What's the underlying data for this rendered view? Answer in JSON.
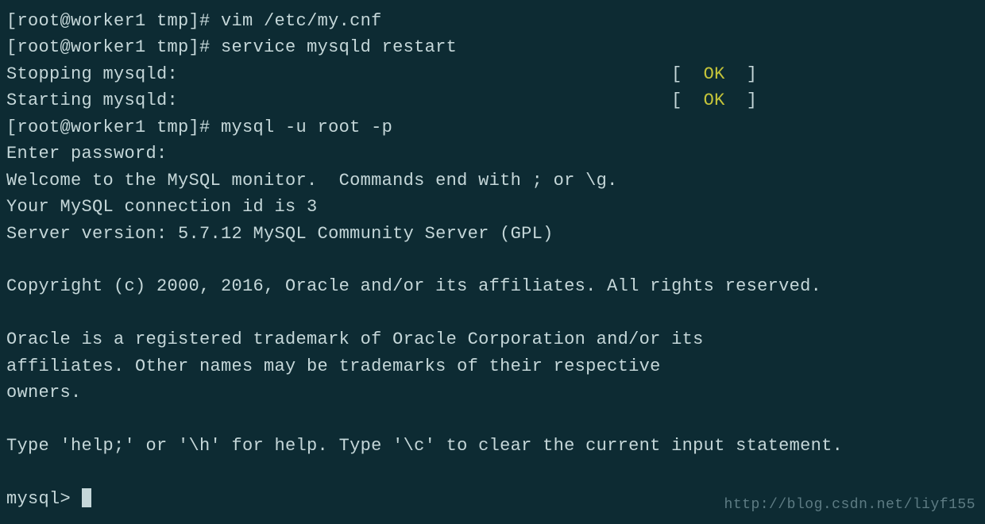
{
  "lines": {
    "l1_prompt": "[root@worker1 tmp]# ",
    "l1_cmd": "vim /etc/my.cnf",
    "l2_prompt": "[root@worker1 tmp]# ",
    "l2_cmd": "service mysqld restart",
    "l3_label": "Stopping mysqld:",
    "l3_gap": "                                              ",
    "l3_b1": "[  ",
    "l3_ok": "OK",
    "l3_b2": "  ]",
    "l4_label": "Starting mysqld:",
    "l4_gap": "                                              ",
    "l4_b1": "[  ",
    "l4_ok": "OK",
    "l4_b2": "  ]",
    "l5_prompt": "[root@worker1 tmp]# ",
    "l5_cmd": "mysql -u root -p",
    "l6": "Enter password:",
    "l7": "Welcome to the MySQL monitor.  Commands end with ; or \\g.",
    "l8": "Your MySQL connection id is 3",
    "l9": "Server version: 5.7.12 MySQL Community Server (GPL)",
    "l10": "Copyright (c) 2000, 2016, Oracle and/or its affiliates. All rights reserved.",
    "l11": "Oracle is a registered trademark of Oracle Corporation and/or its",
    "l12": "affiliates. Other names may be trademarks of their respective",
    "l13": "owners.",
    "l14": "Type 'help;' or '\\h' for help. Type '\\c' to clear the current input statement.",
    "l15_prompt": "mysql> "
  },
  "watermark": "http://blog.csdn.net/liyf155"
}
